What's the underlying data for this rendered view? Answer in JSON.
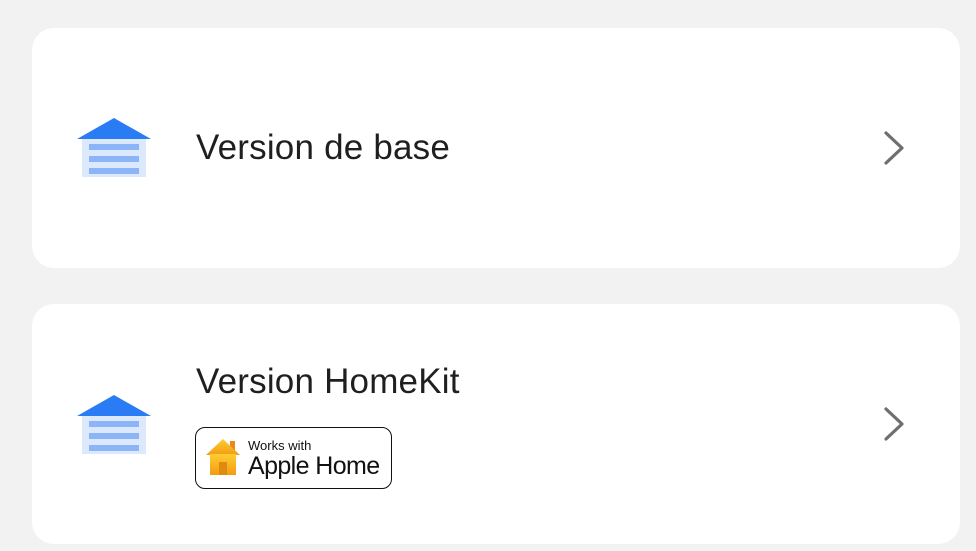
{
  "options": [
    {
      "title": "Version de base",
      "icon": "garage-door-icon"
    },
    {
      "title": "Version HomeKit",
      "icon": "garage-door-icon",
      "badge": {
        "line1": "Works with",
        "line2": "Apple Home",
        "icon": "apple-home-icon"
      }
    }
  ],
  "colors": {
    "background": "#f2f2f2",
    "card": "#ffffff",
    "icon_roof": "#2a7cf5",
    "icon_body": "#dce8fb",
    "icon_slats": "#8bb5f7",
    "chevron": "#6f6f6f",
    "badge_house": "#f5a623"
  }
}
